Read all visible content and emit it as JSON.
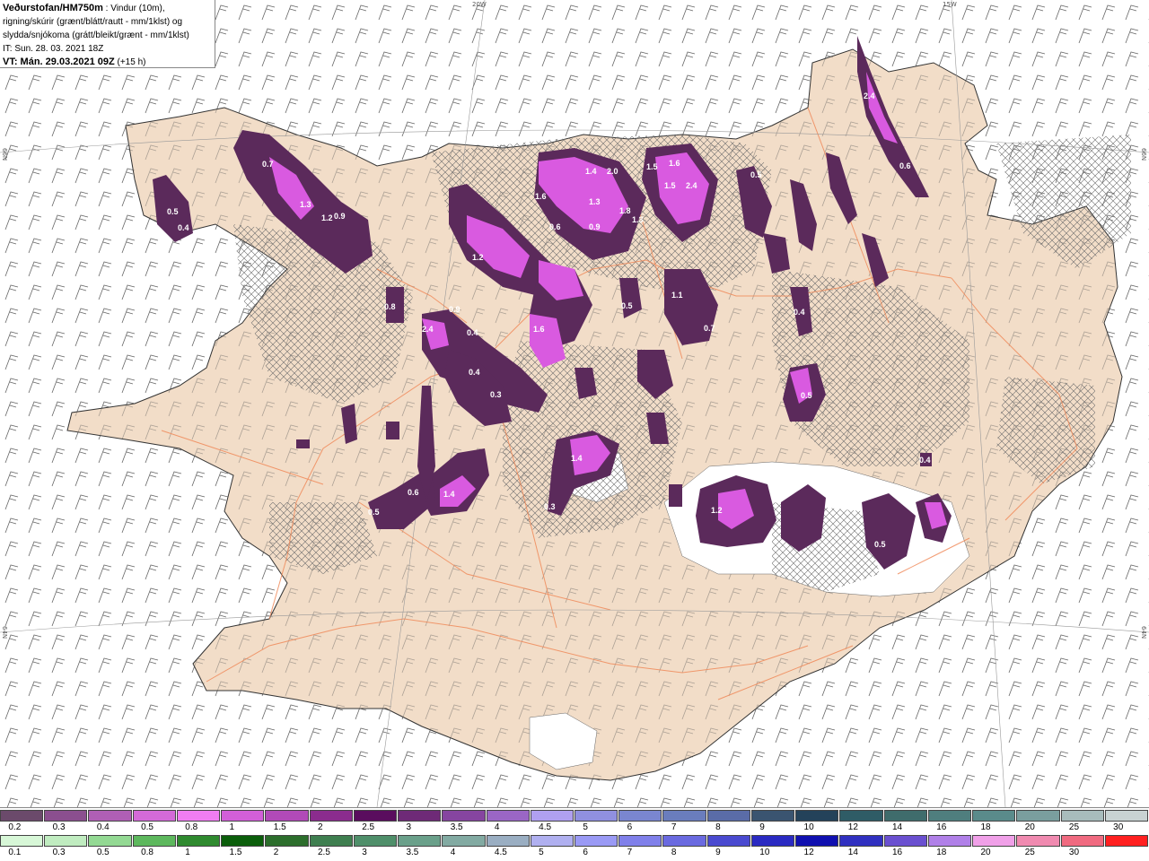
{
  "header": {
    "line1_bold": "Veðurstofan/HM750m",
    "line1_rest": " : Vindur (10m),",
    "line2": "rigning/skúrir (grænt/blátt/rautt - mm/1klst) og",
    "line3": "slydda/snjókoma (grátt/bleikt/grænt - mm/1klst)",
    "line4": "IT: Sun. 28. 03. 2021 18Z",
    "line5_bold": "VT: Mán. 29.03.2021 09Z",
    "line5_rest": " (+15 h)"
  },
  "grid_labels": {
    "top_20w": "20W",
    "top_15w": "15W",
    "left_66n": "66N",
    "right_66n": "66N",
    "left_64n": "64N",
    "right_64n": "64N"
  },
  "map_labels": [
    "0.7",
    "1.3",
    "1.2",
    "0.9",
    "0.5",
    "0.4",
    "0.8",
    "2.4",
    "0.9",
    "0.4",
    "0.4",
    "0.3",
    "1.6",
    "1.4",
    "2.0",
    "1.5",
    "1.6",
    "2.4",
    "1.5",
    "1.3",
    "0.6",
    "0.9",
    "1.8",
    "1.3",
    "1.1",
    "0.5",
    "1.4",
    "0.5",
    "0.5",
    "0.4",
    "0.7",
    "1.6",
    "1.2",
    "0.6",
    "1.4",
    "0.3",
    "1.2",
    "0.5",
    "2.4",
    "0.6",
    "0.5",
    "0.4"
  ],
  "colors": {
    "land": "#f2ddc8",
    "sea": "#ffffff",
    "roads": "#f08a5a",
    "snow_accent": "#d95ae0",
    "snow_dark": "#5b2a5b"
  },
  "legend": {
    "snow_colors": [
      "#6b4a6b",
      "#8b4f8f",
      "#b05fb5",
      "#d46ad8",
      "#f07df2",
      "#d25fd8",
      "#b14ab8",
      "#8b2c8e",
      "#5a0d5e",
      "#6e2a77",
      "#8645a0",
      "#9a66c5",
      "#b0a0f0",
      "#9090e0",
      "#7a86d0",
      "#6a7dbd",
      "#5a6ca8",
      "#3a5470",
      "#24425a",
      "#2f5c66",
      "#3f6c6c",
      "#4f7e7e",
      "#5a8b8b",
      "#7a9e9e",
      "#a8bcbc",
      "#c8d2d2"
    ],
    "snow_ticks": [
      "0.2",
      "0.3",
      "0.4",
      "0.5",
      "0.8",
      "1",
      "1.5",
      "2",
      "2.5",
      "3",
      "3.5",
      "4",
      "4.5",
      "5",
      "6",
      "7",
      "8",
      "9",
      "10",
      "12",
      "14",
      "16",
      "18",
      "20",
      "25",
      "30"
    ],
    "rain_colors": [
      "#d7f7d7",
      "#c0ecc0",
      "#93d993",
      "#5db85d",
      "#2f8a2f",
      "#0b5e0b",
      "#2c6e2c",
      "#3f7f50",
      "#4f8f6a",
      "#6aa08a",
      "#82aaa2",
      "#9aaec2",
      "#b0b0f0",
      "#9a9af5",
      "#8080ea",
      "#6a6ae0",
      "#4a4ad0",
      "#2a2ac2",
      "#1010b0",
      "#3030c0",
      "#6a50d0",
      "#b080e8",
      "#f0a0e8",
      "#f08ab0",
      "#f06a80",
      "#ff2020"
    ],
    "rain_ticks": [
      "0.1",
      "0.3",
      "0.5",
      "0.8",
      "1",
      "1.5",
      "2",
      "2.5",
      "3",
      "3.5",
      "4",
      "4.5",
      "5",
      "6",
      "7",
      "8",
      "9",
      "10",
      "12",
      "14",
      "16",
      "18",
      "20",
      "25",
      "30"
    ]
  }
}
